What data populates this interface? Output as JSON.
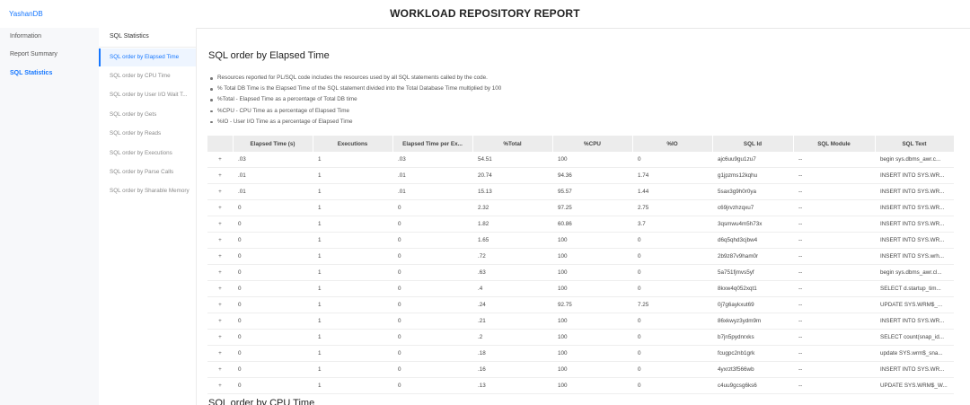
{
  "header": {
    "brand": "YashanDB",
    "title": "WORKLOAD REPOSITORY REPORT"
  },
  "sidebar": {
    "items": [
      {
        "label": "Information"
      },
      {
        "label": "Report Summary"
      },
      {
        "label": "SQL Statistics",
        "active": true
      }
    ]
  },
  "subnav": {
    "title": "SQL Statistics",
    "items": [
      {
        "label": "SQL order by Elapsed Time",
        "active": true
      },
      {
        "label": "SQL order by CPU Time"
      },
      {
        "label": "SQL order by User I/O Wait T..."
      },
      {
        "label": "SQL order by Gets"
      },
      {
        "label": "SQL order by Reads"
      },
      {
        "label": "SQL order by Executions"
      },
      {
        "label": "SQL order by Parse Calls"
      },
      {
        "label": "SQL order by Sharable Memory"
      }
    ]
  },
  "main": {
    "section_title": "SQL order by Elapsed Time",
    "notes": [
      "Resources reported for PL/SQL code includes the resources used by all SQL statements called by the code.",
      "% Total DB Time is the Elapsed Time of the SQL statement divided into the Total Database Time multiplied by 100",
      "%Total - Elapsed Time as a percentage of Total DB time",
      "%CPU - CPU Time as a percentage of Elapsed Time",
      "%IO - User I/O Time as a percentage of Elapsed Time"
    ],
    "table": {
      "columns": [
        "",
        "Elapsed Time (s)",
        "Executions",
        "Elapsed Time per Ex...",
        "%Total",
        "%CPU",
        "%IO",
        "SQL Id",
        "SQL Module",
        "SQL Text"
      ],
      "expand_symbol": "+",
      "rows": [
        [
          ".03",
          "1",
          ".03",
          "54.51",
          "100",
          "0",
          "ajc6uu9gu1zu7",
          "--",
          "begin sys.dbms_awr.c..."
        ],
        [
          ".01",
          "1",
          ".01",
          "20.74",
          "94.36",
          "1.74",
          "g1jpzms12kqhu",
          "--",
          "INSERT INTO SYS.WR..."
        ],
        [
          ".01",
          "1",
          ".01",
          "15.13",
          "95.57",
          "1.44",
          "5sax3g9h0r0ya",
          "--",
          "INSERT INTO SYS.WR..."
        ],
        [
          "0",
          "1",
          "0",
          "2.32",
          "97.25",
          "2.75",
          "c69jrvzhzqxu7",
          "--",
          "INSERT INTO SYS.WR..."
        ],
        [
          "0",
          "1",
          "0",
          "1.82",
          "60.86",
          "3.7",
          "3qsmwu4m5h73x",
          "--",
          "INSERT INTO SYS.WR..."
        ],
        [
          "0",
          "1",
          "0",
          "1.65",
          "100",
          "0",
          "d6q5qhd3cjbw4",
          "--",
          "INSERT INTO SYS.WR..."
        ],
        [
          "0",
          "1",
          "0",
          ".72",
          "100",
          "0",
          "2b9z87v9ham0r",
          "--",
          "INSERT INTO SYS.wrh..."
        ],
        [
          "0",
          "1",
          "0",
          ".63",
          "100",
          "0",
          "5a751fjmvs5yf",
          "--",
          "begin sys.dbms_awr.cl..."
        ],
        [
          "0",
          "1",
          "0",
          ".4",
          "100",
          "0",
          "8kxw4q052xqt1",
          "--",
          "SELECT d.startup_tim..."
        ],
        [
          "0",
          "1",
          "0",
          ".24",
          "92.75",
          "7.25",
          "0j7g6aykxut69",
          "--",
          "UPDATE SYS.WRM$_..."
        ],
        [
          "0",
          "1",
          "0",
          ".21",
          "100",
          "0",
          "86xkwyz3ydm9m",
          "--",
          "INSERT INTO SYS.WR..."
        ],
        [
          "0",
          "1",
          "0",
          ".2",
          "100",
          "0",
          "b7jn5pydnrxks",
          "--",
          "SELECT count(snap_id..."
        ],
        [
          "0",
          "1",
          "0",
          ".18",
          "100",
          "0",
          "fcugpc2nb1grk",
          "--",
          "update SYS.wrm$_sna..."
        ],
        [
          "0",
          "1",
          "0",
          ".16",
          "100",
          "0",
          "4yxrzt3f566wb",
          "--",
          "INSERT INTO SYS.WR..."
        ],
        [
          "0",
          "1",
          "0",
          ".13",
          "100",
          "0",
          "c4uu9gcsg6ks6",
          "--",
          "UPDATE SYS.WRM$_W..."
        ]
      ]
    },
    "next_section_title": "SQL order by CPU Time"
  }
}
